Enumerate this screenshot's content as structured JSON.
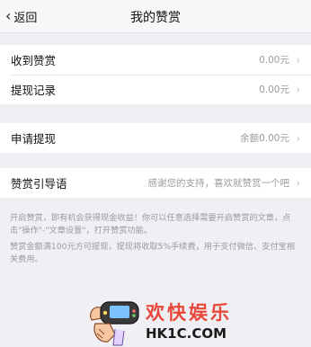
{
  "nav": {
    "back_label": "返回",
    "title": "我的赞赏"
  },
  "group1": {
    "received": {
      "label": "收到赞赏",
      "value": "0.00元"
    },
    "withdraw_records": {
      "label": "提现记录",
      "value": "0.00元"
    }
  },
  "group2": {
    "apply": {
      "label": "申请提现",
      "value": "余额0.00元"
    }
  },
  "group3": {
    "guide": {
      "label": "赞赏引导语",
      "value": "感谢您的支持，喜欢就赞赏一个吧"
    }
  },
  "hints": {
    "line1": "开启赞赏，即有机会获得现金收益！你可以任意选择需要开启赞赏的文章，点击\"操作\"-\"文章设置\"，打开赞赏功能。",
    "line2": "赞赏金额满100元方可提现，提现将收取5%手续费，用于支付微信、支付宝相关费用。"
  },
  "watermark": {
    "title": "欢快娱乐",
    "url": "HK1C.COM"
  },
  "icons": {
    "back": "chevron-left-icon",
    "row_arrow": "chevron-right-icon"
  }
}
